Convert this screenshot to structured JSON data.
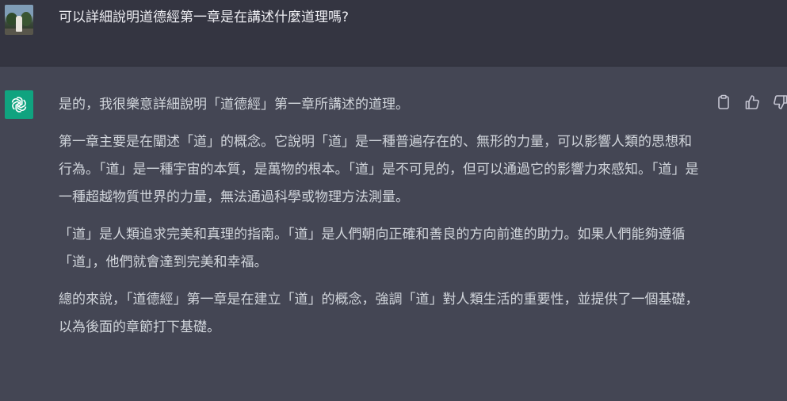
{
  "user_message": {
    "text": "可以詳細說明道德經第一章是在講述什麼道理嗎?"
  },
  "assistant_message": {
    "intro": "是的，我很樂意詳細說明「道德經」第一章所講述的道理。",
    "paragraphs": [
      "第一章主要是在闡述「道」的概念。它說明「道」是一種普遍存在的、無形的力量，可以影響人類的思想和行為。「道」是一種宇宙的本質，是萬物的根本。「道」是不可見的，但可以通過它的影響力來感知。「道」是一種超越物質世界的力量，無法通過科學或物理方法測量。",
      "「道」是人類追求完美和真理的指南。「道」是人們朝向正確和善良的方向前進的助力。如果人們能夠遵循「道」，他們就會達到完美和幸福。",
      "總的來說，「道德經」第一章是在建立「道」的概念，強調「道」對人類生活的重要性，並提供了一個基礎，以為後面的章節打下基礎。"
    ]
  },
  "icons": {
    "copy": "clipboard-icon",
    "like": "thumbs-up-icon",
    "dislike": "thumbs-down-icon",
    "assistant_logo": "openai-logo-icon",
    "user_avatar": "user-avatar-photo"
  },
  "colors": {
    "user_row_bg": "#343541",
    "assistant_row_bg": "#444654",
    "logo_bg": "#10a37f",
    "text_primary": "#ececf1",
    "text_secondary": "#d1d5db",
    "icon_color": "#c5c5d2"
  }
}
